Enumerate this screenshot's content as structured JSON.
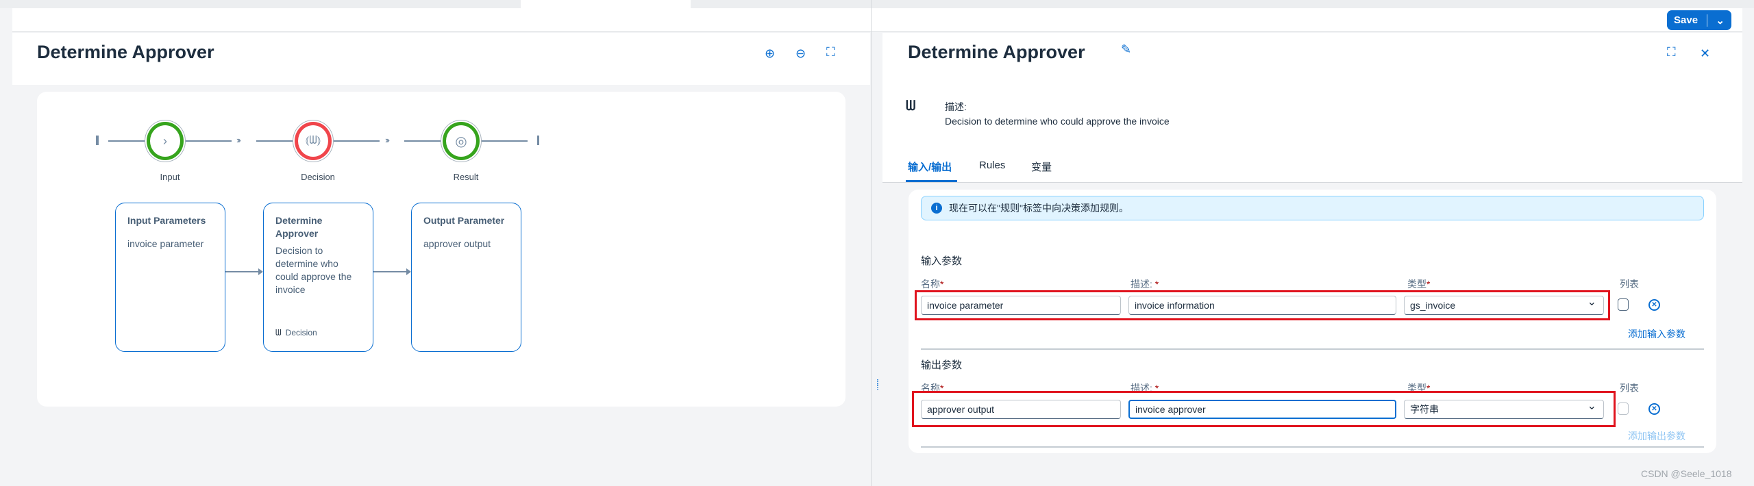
{
  "toolbar": {
    "save_label": "Save"
  },
  "left": {
    "title": "Determine Approver",
    "flow": [
      {
        "label": "Input",
        "status_color": "#36a41d",
        "icon": "chevron-right-icon"
      },
      {
        "label": "Decision",
        "status_color": "#f0454b",
        "icon": "decision-icon"
      },
      {
        "label": "Result",
        "status_color": "#36a41d",
        "icon": "target-icon"
      }
    ],
    "boxes": [
      {
        "title": "Input Parameters",
        "body": "invoice parameter"
      },
      {
        "title": "Determine Approver",
        "body": "Decision to determine who could approve the invoice",
        "footer": "Decision"
      },
      {
        "title": "Output Parameter",
        "body": "approver output"
      }
    ]
  },
  "right": {
    "title": "Determine Approver",
    "desc_label": "描述:",
    "desc_text": "Decision to determine who could approve the invoice",
    "tabs": [
      "输入/输出",
      "Rules",
      "变量"
    ],
    "info": "现在可以在\"规则\"标签中向决策添加规则。",
    "input_section": {
      "title": "输入参数",
      "col_name": "名称",
      "col_desc": "描述:",
      "col_type": "类型",
      "col_list": "列表",
      "name": "invoice parameter",
      "desc": "invoice information",
      "type": "gs_invoice",
      "add": "添加输入参数"
    },
    "output_section": {
      "title": "输出参数",
      "col_name": "名称",
      "col_desc": "描述:",
      "col_type": "类型",
      "col_list": "列表",
      "name": "approver output",
      "desc": "invoice approver",
      "type": "字符串",
      "add": "添加输出参数"
    }
  },
  "watermark": "CSDN @Seele_1018",
  "colors": {
    "accent": "#0a6ed1",
    "highlight": "#e0141e"
  }
}
